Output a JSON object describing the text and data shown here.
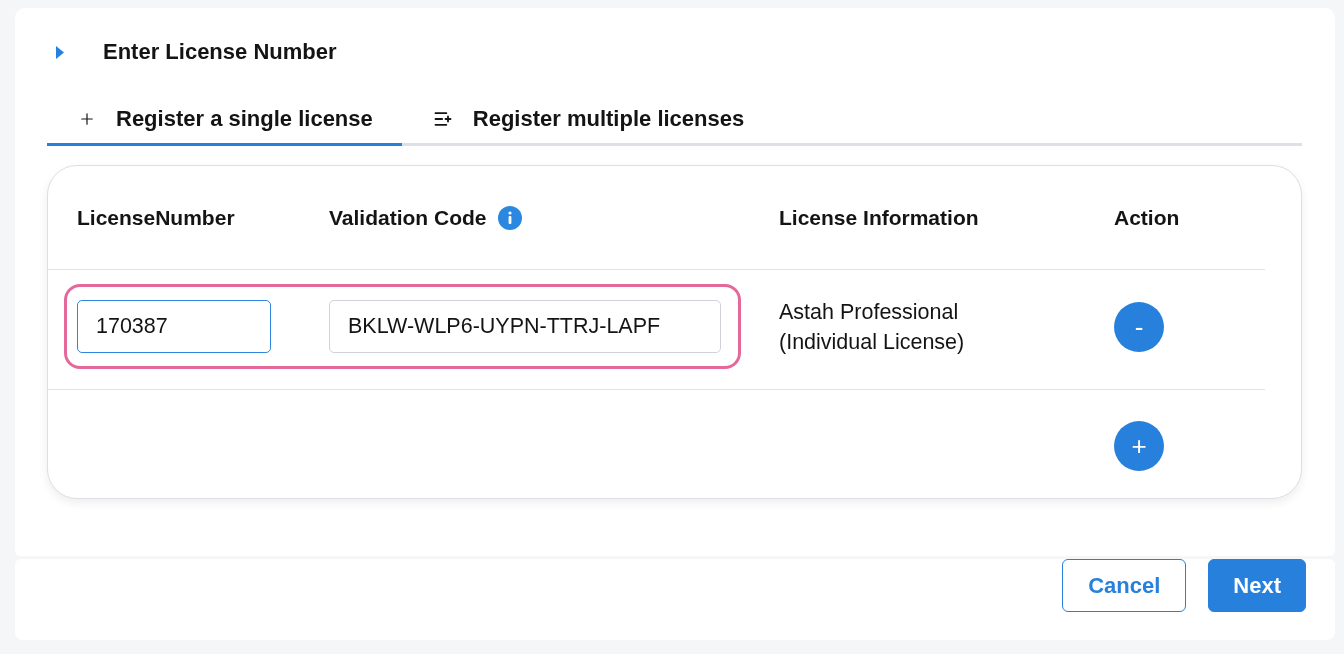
{
  "section": {
    "title": "Enter License Number"
  },
  "tabs": [
    {
      "label": "Register a single license",
      "selected": true
    },
    {
      "label": "Register multiple licenses",
      "selected": false
    }
  ],
  "table": {
    "columns": [
      {
        "label": "LicenseNumber",
        "info": false
      },
      {
        "label": "Validation Code",
        "info": true
      },
      {
        "label": "License Information",
        "info": false
      },
      {
        "label": "Action",
        "info": false
      }
    ],
    "rows": [
      {
        "highlighted": true,
        "license_number": {
          "value": "170387",
          "focused": true
        },
        "validation_code": {
          "value": "BKLW-WLP6-UYPN-TTRJ-LAPF",
          "focused": false
        },
        "license_information": "Astah Professional (Individual License)",
        "action": "-"
      }
    ],
    "add_action": "+"
  },
  "buttons": [
    {
      "label": "Cancel",
      "kind": "secondary"
    },
    {
      "label": "Next",
      "kind": "primary"
    }
  ]
}
